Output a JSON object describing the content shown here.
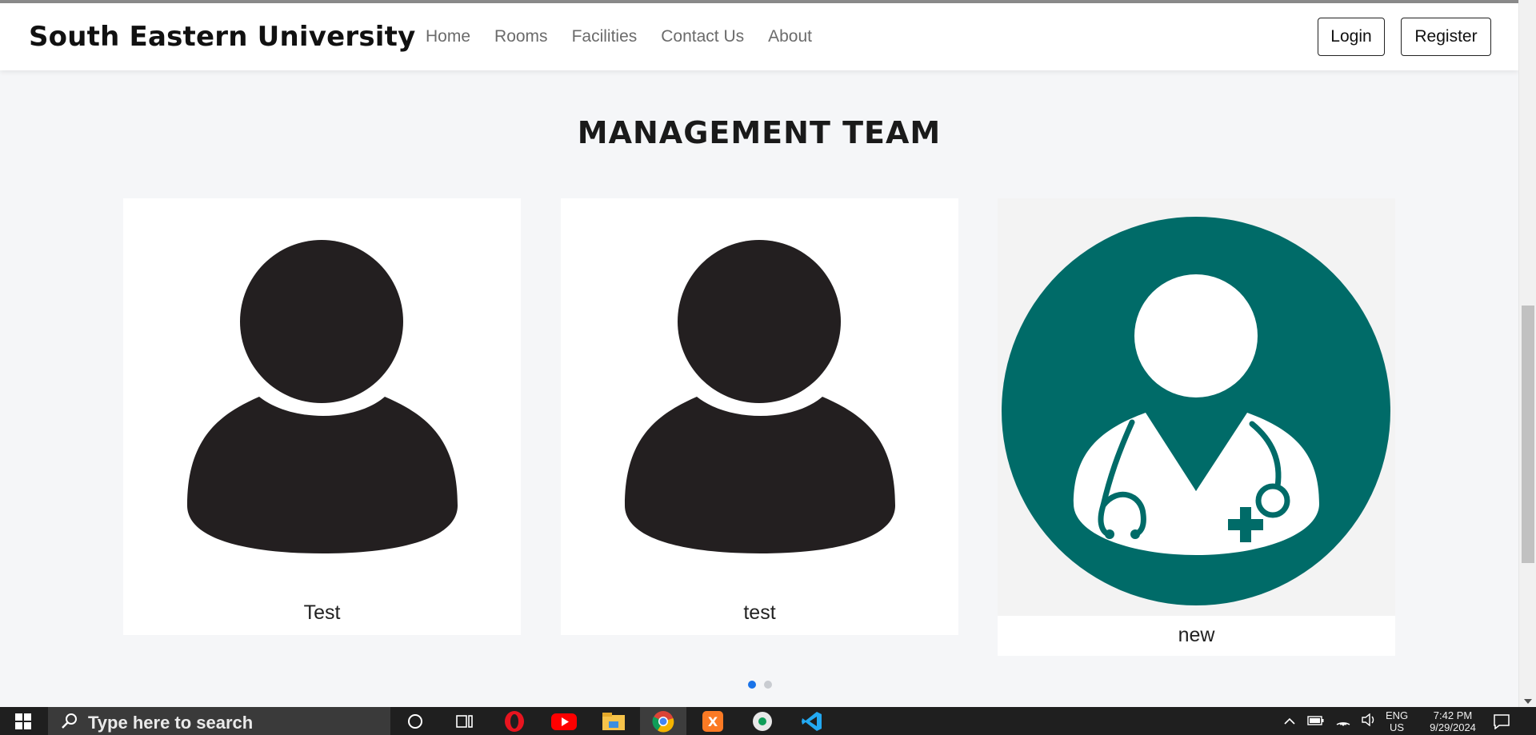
{
  "nav": {
    "brand": "South Eastern University",
    "links": [
      "Home",
      "Rooms",
      "Facilities",
      "Contact Us",
      "About"
    ],
    "login": "Login",
    "register": "Register"
  },
  "section": {
    "title": "MANAGEMENT TEAM"
  },
  "team": [
    {
      "name": "Test",
      "avatar": "person-silhouette-icon"
    },
    {
      "name": "test",
      "avatar": "person-silhouette-icon"
    },
    {
      "name": "new",
      "avatar": "doctor-icon"
    }
  ],
  "carousel": {
    "pages": 2,
    "active": 1
  },
  "taskbar": {
    "search_placeholder": "Type here to search",
    "lang_line1": "ENG",
    "lang_line2": "US",
    "time": "7:42 PM",
    "date": "9/29/2024",
    "apps": [
      "cortana-icon",
      "task-view-icon",
      "opera-icon",
      "youtube-icon",
      "file-explorer-icon",
      "chrome-icon",
      "xampp-icon",
      "chrome-alt-icon",
      "vscode-icon"
    ]
  },
  "colors": {
    "accent": "#1a73e8",
    "doctor_bg": "#006b68",
    "silhouette": "#231f20"
  }
}
